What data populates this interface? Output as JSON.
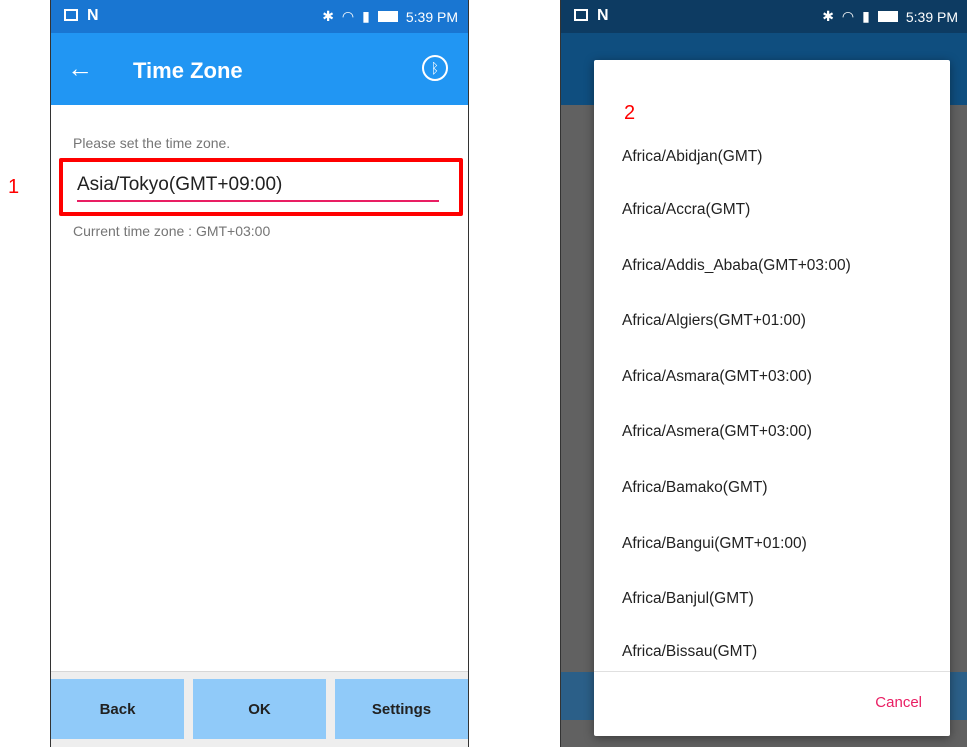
{
  "callouts": {
    "left": "1",
    "right": "2"
  },
  "status_bar": {
    "time": "5:39 PM"
  },
  "left_screen": {
    "title": "Time Zone",
    "prompt": "Please set the time zone.",
    "timezone_value": "Asia/Tokyo(GMT+09:00)",
    "current_timezone": "Current time zone : GMT+03:00",
    "buttons": {
      "back": "Back",
      "ok": "OK",
      "settings": "Settings"
    }
  },
  "right_screen": {
    "dialog_items": [
      "Africa/Abidjan(GMT)",
      "Africa/Accra(GMT)",
      "Africa/Addis_Ababa(GMT+03:00)",
      "Africa/Algiers(GMT+01:00)",
      "Africa/Asmara(GMT+03:00)",
      "Africa/Asmera(GMT+03:00)",
      "Africa/Bamako(GMT)",
      "Africa/Bangui(GMT+01:00)",
      "Africa/Banjul(GMT)",
      "Africa/Bissau(GMT)"
    ],
    "cancel_label": "Cancel"
  },
  "colors": {
    "accent": "#2196f3",
    "highlight": "#ff0000",
    "pink": "#e91e63"
  }
}
